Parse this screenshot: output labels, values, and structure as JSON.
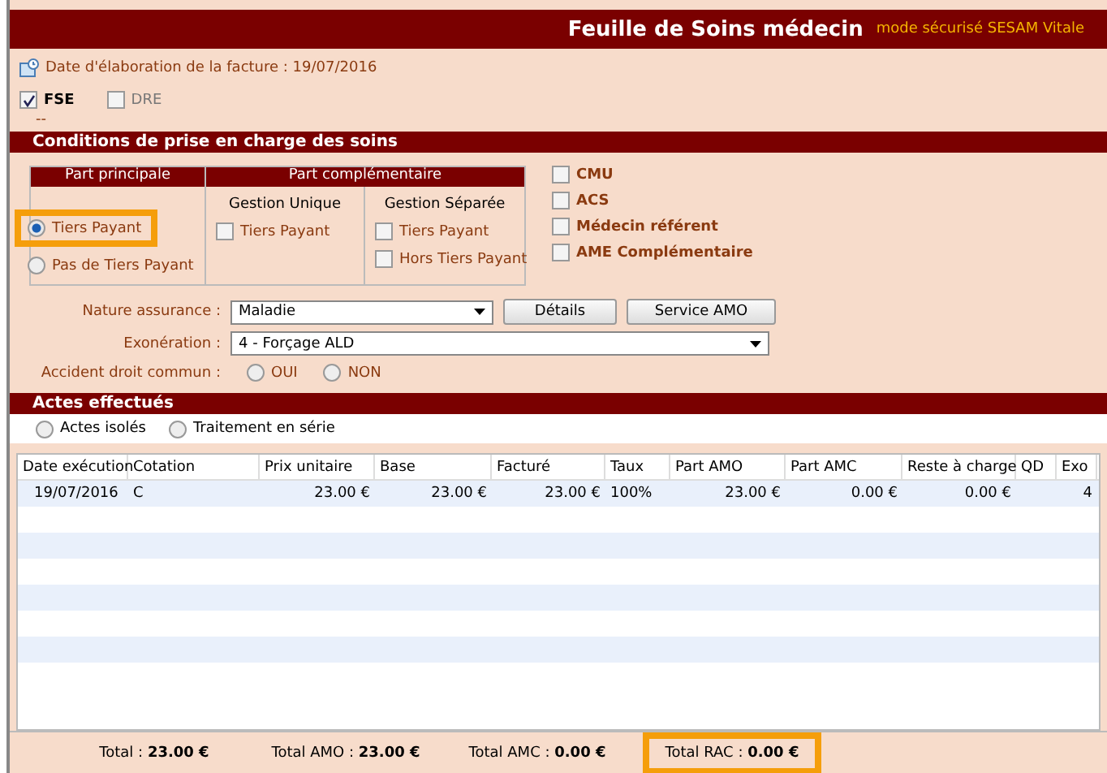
{
  "window": {
    "title": "Feuille de Soins médecin",
    "mode": "mode sécurisé SESAM Vitale"
  },
  "invoice_date": "Date d'élaboration de la facture : 19/07/2016",
  "doc_types": [
    {
      "label": "FSE",
      "checked": true
    },
    {
      "label": "DRE",
      "checked": false
    }
  ],
  "separator_text": "--",
  "conditions": {
    "title": "Conditions de prise en charge des soins",
    "part_principale": {
      "title": "Part principale",
      "options": [
        {
          "label": "Tiers Payant",
          "selected": true,
          "highlighted": true
        },
        {
          "label": "Pas de Tiers Payant",
          "selected": false,
          "highlighted": false
        }
      ]
    },
    "part_complementaire": {
      "title": "Part complémentaire",
      "groups": [
        {
          "title": "Gestion Unique",
          "options": [
            {
              "label": "Tiers Payant",
              "checked": false
            }
          ]
        },
        {
          "title": "Gestion Séparée",
          "options": [
            {
              "label": "Tiers Payant",
              "checked": false
            },
            {
              "label": "Hors Tiers Payant",
              "checked": false
            }
          ]
        }
      ]
    },
    "flags": [
      {
        "label": "CMU",
        "checked": false
      },
      {
        "label": "ACS",
        "checked": false
      },
      {
        "label": "Médecin référent",
        "checked": false
      },
      {
        "label": "AME Complémentaire",
        "checked": false
      }
    ],
    "nature_assurance": {
      "label": "Nature assurance :",
      "value": "Maladie"
    },
    "buttons": [
      "Détails",
      "Service AMO"
    ],
    "exoneration": {
      "label": "Exonération :",
      "value": "4 - Forçage ALD"
    },
    "accident": {
      "label": "Accident droit commun :",
      "options": [
        {
          "label": "OUI",
          "selected": false
        },
        {
          "label": "NON",
          "selected": false
        }
      ]
    }
  },
  "actes": {
    "title": "Actes effectués",
    "modes": [
      {
        "label": "Actes isolés",
        "selected": false
      },
      {
        "label": "Traitement en série",
        "selected": false
      }
    ],
    "columns": [
      "Date exécution",
      "Cotation",
      "Prix unitaire",
      "Base",
      "Facturé",
      "Taux",
      "Part AMO",
      "Part AMC",
      "Reste à charge",
      "QD",
      "Exo"
    ],
    "rows": [
      [
        "19/07/2016",
        "C",
        "23.00 €",
        "23.00 €",
        "23.00 €",
        "100%",
        "23.00 €",
        "0.00 €",
        "0.00 €",
        "",
        "4"
      ]
    ]
  },
  "totals": [
    {
      "label": "Total :",
      "value": "23.00 €",
      "highlighted": false
    },
    {
      "label": "Total AMO :",
      "value": "23.00 €",
      "highlighted": false
    },
    {
      "label": "Total AMC :",
      "value": "0.00 €",
      "highlighted": false
    },
    {
      "label": "Total RAC :",
      "value": "0.00 €",
      "highlighted": true
    }
  ]
}
